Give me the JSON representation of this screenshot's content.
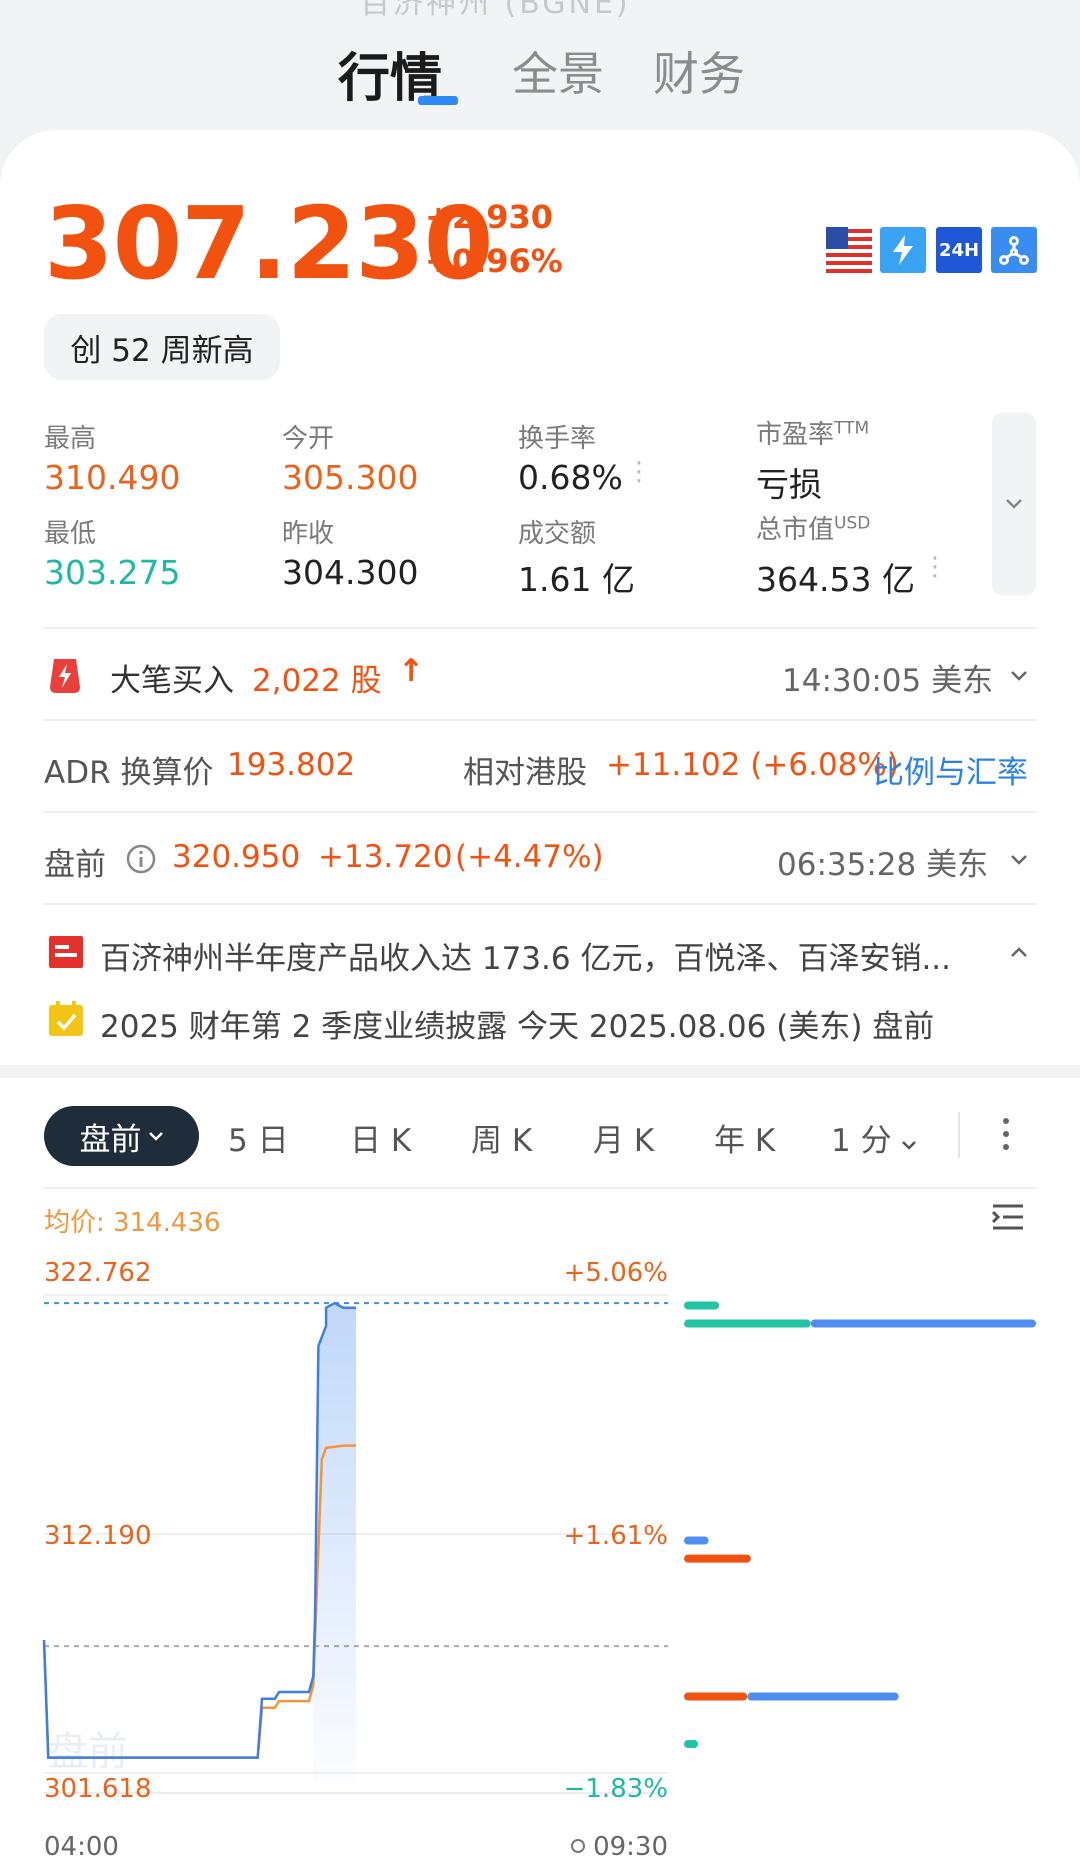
{
  "top": {
    "ghost_title": "百济神州 (BGNE)",
    "tabs": [
      {
        "label": "行情",
        "active": true
      },
      {
        "label": "全景",
        "active": false
      },
      {
        "label": "财务",
        "active": false
      }
    ]
  },
  "quote": {
    "price": "307.230",
    "change": "+2.930",
    "change_pct": "+0.96%",
    "badge_24h": "24H",
    "new_high_pill": "创 52 周新高"
  },
  "stats": {
    "high_label": "最高",
    "high_value": "310.490",
    "open_label": "今开",
    "open_value": "305.300",
    "turnover_label": "换手率",
    "turnover_value": "0.68%",
    "pe_label": "市盈率",
    "pe_sup": "TTM",
    "pe_value": "亏损",
    "low_label": "最低",
    "low_value": "303.275",
    "prev_close_label": "昨收",
    "prev_close_value": "304.300",
    "amount_label": "成交额",
    "amount_value": "1.61 亿",
    "mktcap_label": "总市值",
    "mktcap_sup": "USD",
    "mktcap_value": "364.53 亿"
  },
  "big_order": {
    "label": "大笔买入",
    "amount": "2,022 股",
    "arrow": "↑",
    "time": "14:30:05 美东"
  },
  "adr": {
    "label": "ADR 换算价",
    "value": "193.802",
    "relative_label": "相对港股",
    "relative_value": "+11.102 (+6.08%)",
    "link": "比例与汇率"
  },
  "premarket": {
    "label": "盘前",
    "price": "320.950",
    "change": "+13.720",
    "change_pct": "(+4.47%)",
    "time": "06:35:28 美东"
  },
  "news": {
    "headline": "百济神州半年度产品收入达 173.6 亿元，百悦泽、百泽安销...",
    "earnings": "2025 财年第 2 季度业绩披露 今天 2025.08.06 (美东) 盘前"
  },
  "periods": {
    "selected": "盘前",
    "items": [
      "5 日",
      "日 K",
      "周 K",
      "月 K",
      "年 K",
      "1 分"
    ]
  },
  "chart_data": {
    "type": "line",
    "avg_label": "均价: 314.436",
    "watermark": "盘前",
    "y_ticks_left": [
      "322.762",
      "312.190",
      "301.618"
    ],
    "y_ticks_right": [
      "+5.06%",
      "+1.61%",
      "−1.83%"
    ],
    "x_ticks": [
      "04:00",
      "09:30"
    ],
    "ylim": [
      301.618,
      322.762
    ],
    "prev_close": 307.23,
    "colors": {
      "price": "#3f7fe0",
      "avg": "#f0963c"
    },
    "series": [
      {
        "key": "price",
        "points": [
          [
            0,
            307.5
          ],
          [
            0.5,
            302.3
          ],
          [
            25,
            302.3
          ],
          [
            25.5,
            304.9
          ],
          [
            27,
            304.9
          ],
          [
            27.5,
            305.2
          ],
          [
            31,
            305.2
          ],
          [
            31.5,
            305.9
          ],
          [
            31.7,
            308.5
          ],
          [
            32.1,
            320.5
          ],
          [
            32.6,
            321.0
          ],
          [
            33,
            321.4
          ],
          [
            33,
            322.2
          ],
          [
            34,
            322.4
          ],
          [
            35,
            322.2
          ],
          [
            36.5,
            322.2
          ]
        ]
      },
      {
        "key": "avg",
        "points": [
          [
            0,
            307.5
          ],
          [
            0.5,
            302.3
          ],
          [
            25,
            302.3
          ],
          [
            25.5,
            304.5
          ],
          [
            27,
            304.5
          ],
          [
            27.5,
            304.8
          ],
          [
            31,
            304.8
          ],
          [
            31.5,
            305.5
          ],
          [
            32,
            310.5
          ],
          [
            32.5,
            315.5
          ],
          [
            33,
            316.0
          ],
          [
            35,
            316.1
          ],
          [
            36.5,
            316.1
          ]
        ]
      }
    ],
    "depth_bars": [
      {
        "y": 322.3,
        "teal": 0.1,
        "blue": 0.0
      },
      {
        "y": 321.5,
        "teal": 0.36,
        "blue": 0.64
      },
      {
        "y": 311.9,
        "blue": 0.07,
        "orange": 0.0
      },
      {
        "y": 311.1,
        "orange": 0.19
      },
      {
        "y": 305.0,
        "orange": 0.18,
        "blue": 0.43
      },
      {
        "y": 302.9,
        "teal": 0.04
      }
    ]
  }
}
